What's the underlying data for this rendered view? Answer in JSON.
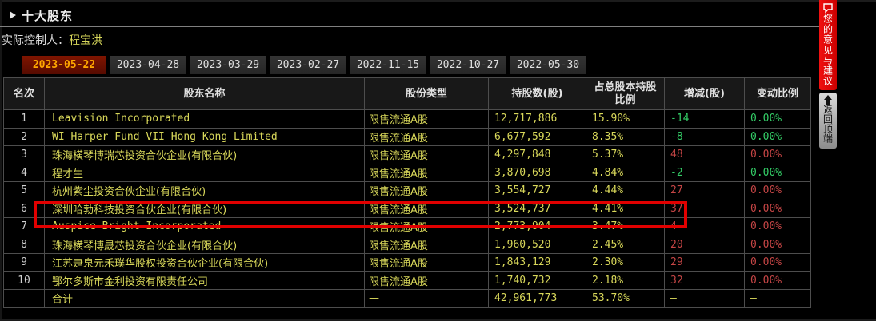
{
  "panel": {
    "title": "十大股东",
    "controller_label": "实际控制人：",
    "controller_name": "程宝洪"
  },
  "tabs": [
    {
      "label": "2023-05-22",
      "state": "active"
    },
    {
      "label": "2023-04-28",
      "state": "inactive"
    },
    {
      "label": "2023-03-29",
      "state": "inactive"
    },
    {
      "label": "2023-02-27",
      "state": "inactive"
    },
    {
      "label": "2022-11-15",
      "state": "inactive"
    },
    {
      "label": "2022-10-27",
      "state": "inactive"
    },
    {
      "label": "2022-05-30",
      "state": "inactive"
    }
  ],
  "table": {
    "headers": [
      "名次",
      "股东名称",
      "股份类型",
      "持股数(股)",
      "占总股本持股比例",
      "增减(股)",
      "变动比例"
    ],
    "rows": [
      {
        "rank": "1",
        "name": "Leavision Incorporated",
        "type": "限售流通A股",
        "shares": "12,717,886",
        "pct": "15.90%",
        "change": "-14",
        "change_pct": "0.00%",
        "trend": "down"
      },
      {
        "rank": "2",
        "name": "WI Harper Fund VII Hong Kong Limited",
        "type": "限售流通A股",
        "shares": "6,677,592",
        "pct": "8.35%",
        "change": "-8",
        "change_pct": "0.00%",
        "trend": "down"
      },
      {
        "rank": "3",
        "name": "珠海横琴博瑞芯投资合伙企业(有限合伙)",
        "type": "限售流通A股",
        "shares": "4,297,848",
        "pct": "5.37%",
        "change": "48",
        "change_pct": "0.00%",
        "trend": "up"
      },
      {
        "rank": "4",
        "name": "程才生",
        "type": "限售流通A股",
        "shares": "3,870,698",
        "pct": "4.84%",
        "change": "-2",
        "change_pct": "0.00%",
        "trend": "down"
      },
      {
        "rank": "5",
        "name": "杭州紫尘投资合伙企业(有限合伙)",
        "type": "限售流通A股",
        "shares": "3,554,727",
        "pct": "4.44%",
        "change": "27",
        "change_pct": "0.00%",
        "trend": "up"
      },
      {
        "rank": "6",
        "name": "深圳哈勃科技投资合伙企业(有限合伙)",
        "type": "限售流通A股",
        "shares": "3,524,737",
        "pct": "4.41%",
        "change": "37",
        "change_pct": "0.00%",
        "trend": "up"
      },
      {
        "rank": "7",
        "name": "Auspice Bright Incorporated",
        "type": "限售流通A股",
        "shares": "2,773,904",
        "pct": "3.47%",
        "change": "4",
        "change_pct": "0.00%",
        "trend": "up"
      },
      {
        "rank": "8",
        "name": "珠海横琴博晟芯投资合伙企业(有限合伙)",
        "type": "限售流通A股",
        "shares": "1,960,520",
        "pct": "2.45%",
        "change": "20",
        "change_pct": "0.00%",
        "trend": "up"
      },
      {
        "rank": "9",
        "name": "江苏疌泉元禾璞华股权投资合伙企业(有限合伙)",
        "type": "限售流通A股",
        "shares": "1,843,129",
        "pct": "2.30%",
        "change": "29",
        "change_pct": "0.00%",
        "trend": "up"
      },
      {
        "rank": "10",
        "name": "鄂尔多斯市金利投资有限责任公司",
        "type": "限售流通A股",
        "shares": "1,740,732",
        "pct": "2.18%",
        "change": "32",
        "change_pct": "0.00%",
        "trend": "up"
      }
    ],
    "total_row": {
      "rank": "",
      "name": "合计",
      "type": "—",
      "shares": "42,961,773",
      "pct": "53.70%",
      "change": "—",
      "change_pct": "—",
      "trend": "flat"
    }
  },
  "annotation": {
    "highlighted_rank": "6"
  },
  "sidebar": {
    "feedback_label": "您的意见与建议",
    "back_to_top_label": "返回顶端"
  },
  "colors": {
    "background": "#000000",
    "shareholder_yellow": "#d8d75a",
    "increase_red": "#c54545",
    "decrease_green": "#33cc66",
    "active_tab_bg": "#6e1000",
    "active_tab_text": "#ffa800",
    "banner_red": "#e10000"
  }
}
